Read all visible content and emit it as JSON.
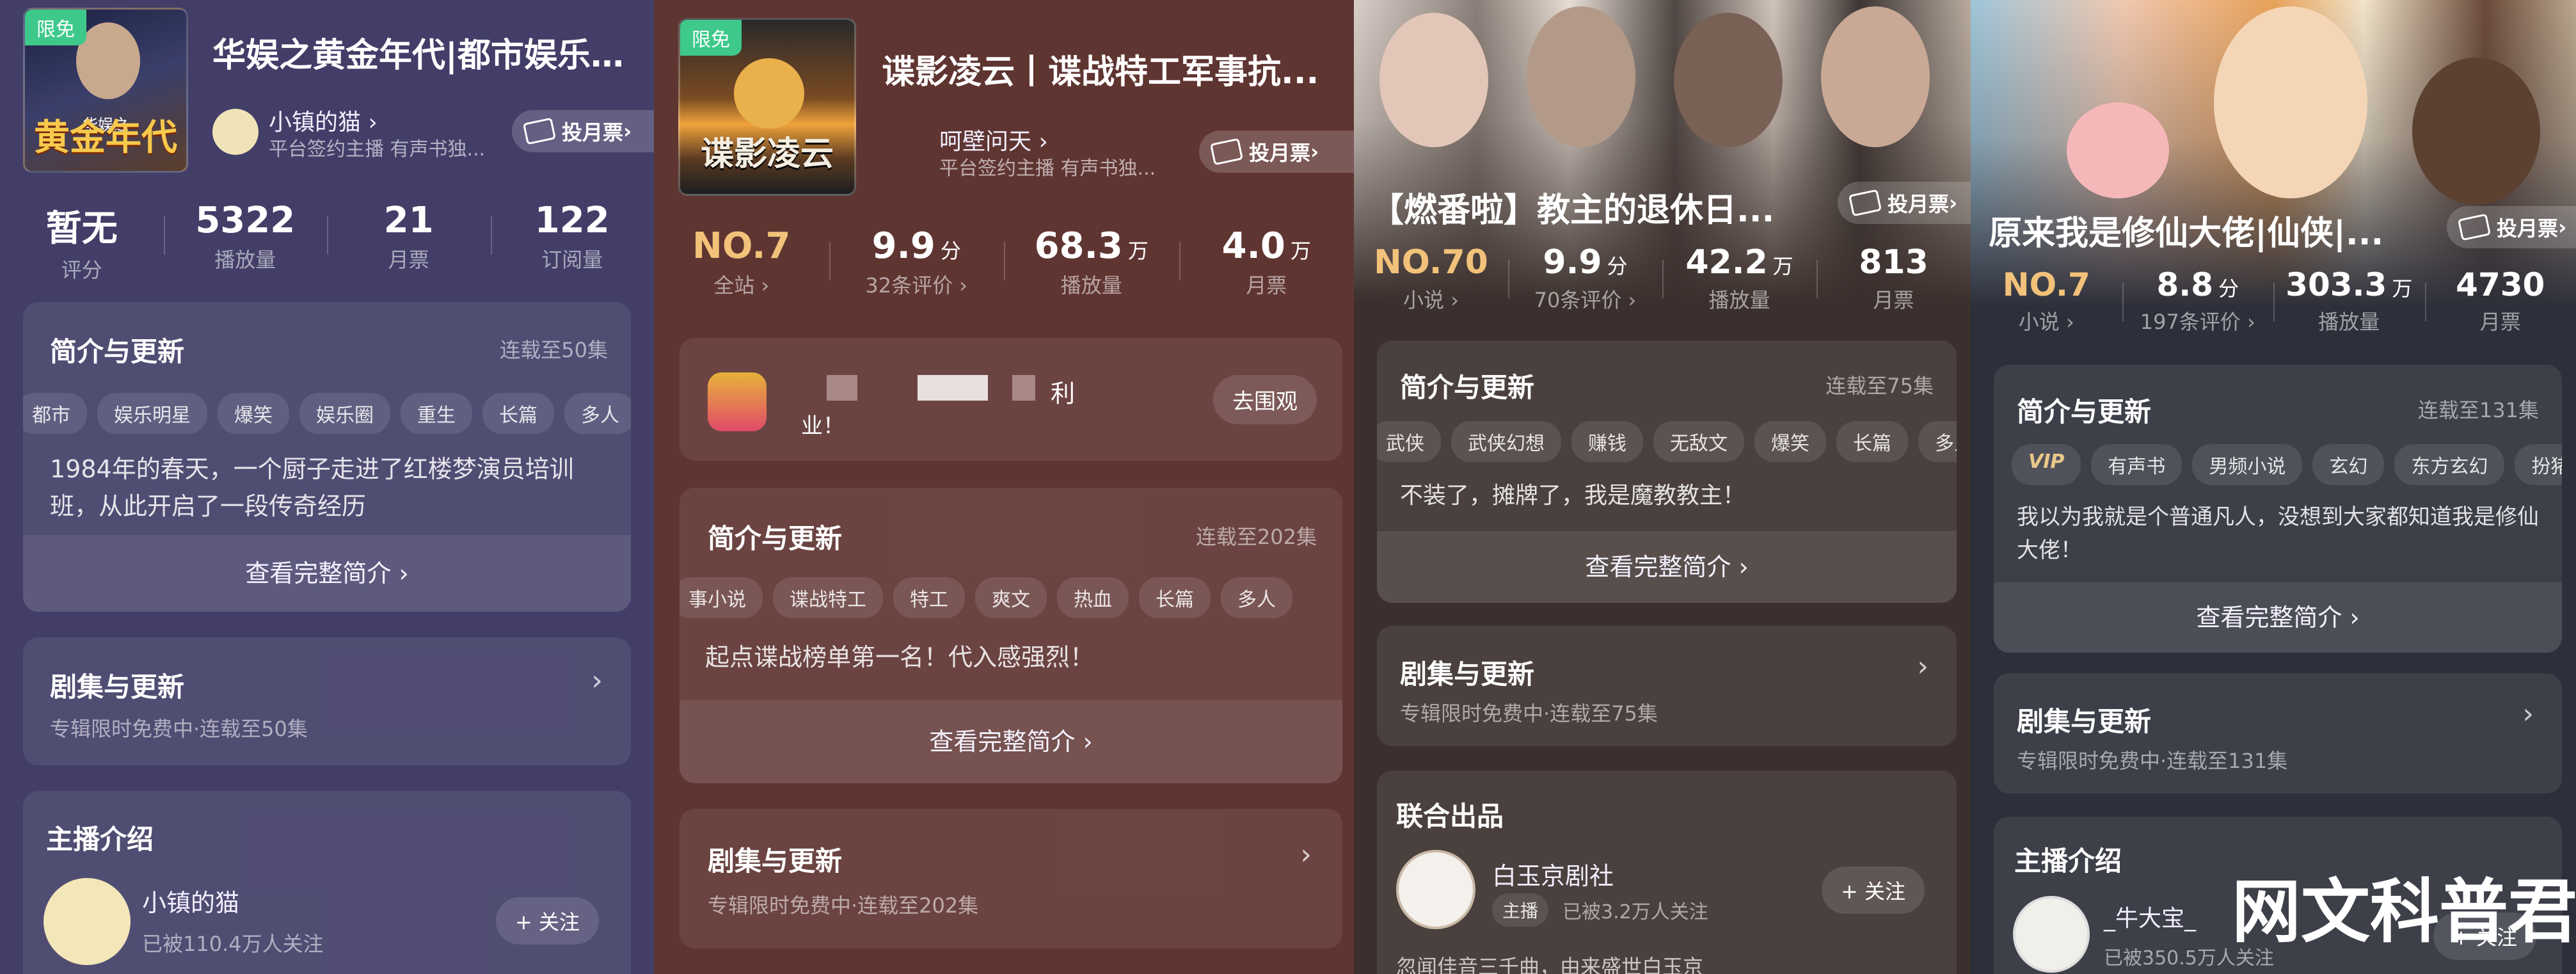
{
  "panels": [
    {
      "badge": "限免",
      "cover_text": "黄金年代",
      "cover_sub": "华娱之",
      "title": "华娱之黄金年代|都市娱乐圈...",
      "anchor_name": "小镇的猫",
      "anchor_role": "平台签约主播   有声书独...",
      "ticket": "投月票",
      "stats": [
        {
          "value": "暂无",
          "unit": "",
          "label": "评分"
        },
        {
          "value": "5322",
          "unit": "",
          "label": "播放量"
        },
        {
          "value": "21",
          "unit": "",
          "label": "月票"
        },
        {
          "value": "122",
          "unit": "",
          "label": "订阅量"
        }
      ],
      "intro_title": "简介与更新",
      "intro_right": "连载至50集",
      "tags": [
        "都市",
        "娱乐明星",
        "爆笑",
        "娱乐圈",
        "重生",
        "长篇",
        "多人"
      ],
      "desc": "1984年的春天，一个厨子走进了红楼梦演员培训班，从此开启了一段传奇经历",
      "more": "查看完整简介",
      "episodes_title": "剧集与更新",
      "episodes_sub": "专辑限时免费中·连载至50集",
      "host_title": "主播介绍",
      "host_name": "小镇的猫",
      "host_followers": "已被110.4万人关注",
      "follow": "+ 关注"
    },
    {
      "badge": "限免",
      "cover_text": "谍影凌云",
      "title": "谍影凌云丨谍战特工军事抗...",
      "anchor_name": "呵壁问天",
      "anchor_role": "平台签约主播   有声书独...",
      "ticket": "投月票",
      "stats": [
        {
          "value": "NO.7",
          "unit": "",
          "label": "全站"
        },
        {
          "value": "9.9",
          "unit": "分",
          "label": "32条评价"
        },
        {
          "value": "68.3",
          "unit": "万",
          "label": "播放量"
        },
        {
          "value": "4.0",
          "unit": "万",
          "label": "月票"
        }
      ],
      "promo_text": "利",
      "promo_text2": "业！",
      "promo_button": "去围观",
      "intro_title": "简介与更新",
      "intro_right": "连载至202集",
      "tags": [
        "事小说",
        "谍战特工",
        "特工",
        "爽文",
        "热血",
        "长篇",
        "多人"
      ],
      "desc": "起点谍战榜单第一名！代入感强烈！",
      "more": "查看完整简介",
      "episodes_title": "剧集与更新",
      "episodes_sub": "专辑限时免费中·连载至202集"
    },
    {
      "title": "【燃番啦】教主的退休日...",
      "ticket": "投月票",
      "stats": [
        {
          "value": "NO.70",
          "unit": "",
          "label": "小说"
        },
        {
          "value": "9.9",
          "unit": "分",
          "label": "70条评价"
        },
        {
          "value": "42.2",
          "unit": "万",
          "label": "播放量"
        },
        {
          "value": "813",
          "unit": "",
          "label": "月票"
        }
      ],
      "intro_title": "简介与更新",
      "intro_right": "连载至75集",
      "tags": [
        "武侠",
        "武侠幻想",
        "赚钱",
        "无敌文",
        "爆笑",
        "长篇",
        "多人"
      ],
      "desc": "不装了，摊牌了，我是魔教教主！",
      "more": "查看完整简介",
      "episodes_title": "剧集与更新",
      "episodes_sub": "专辑限时免费中·连载至75集",
      "joint_title": "联合出品",
      "joint_name": "白玉京剧社",
      "joint_role": "主播",
      "joint_followers": "已被3.2万人关注",
      "joint_follow": "+ 关注",
      "joint_desc": "忽闻佳音三千曲，由来盛世白玉京"
    },
    {
      "title": "原来我是修仙大佬|仙侠|...",
      "ticket": "投月票",
      "stats": [
        {
          "value": "NO.7",
          "unit": "",
          "label": "小说"
        },
        {
          "value": "8.8",
          "unit": "分",
          "label": "197条评价"
        },
        {
          "value": "303.3",
          "unit": "万",
          "label": "播放量"
        },
        {
          "value": "4730",
          "unit": "",
          "label": "月票"
        }
      ],
      "intro_title": "简介与更新",
      "intro_right": "连载至131集",
      "tags": [
        "VIP",
        "有声书",
        "男频小说",
        "玄幻",
        "东方玄幻",
        "扮猪吃"
      ],
      "desc": "我以为我就是个普通凡人，没想到大家都知道我是修仙大佬！",
      "more": "查看完整简介",
      "episodes_title": "剧集与更新",
      "episodes_sub": "专辑限时免费中·连载至131集",
      "host_title": "主播介绍",
      "host_name": "_牛大宝_",
      "host_followers": "已被350.5万人关注",
      "follow": "+ 关注",
      "watermark": "网文科普君"
    }
  ]
}
